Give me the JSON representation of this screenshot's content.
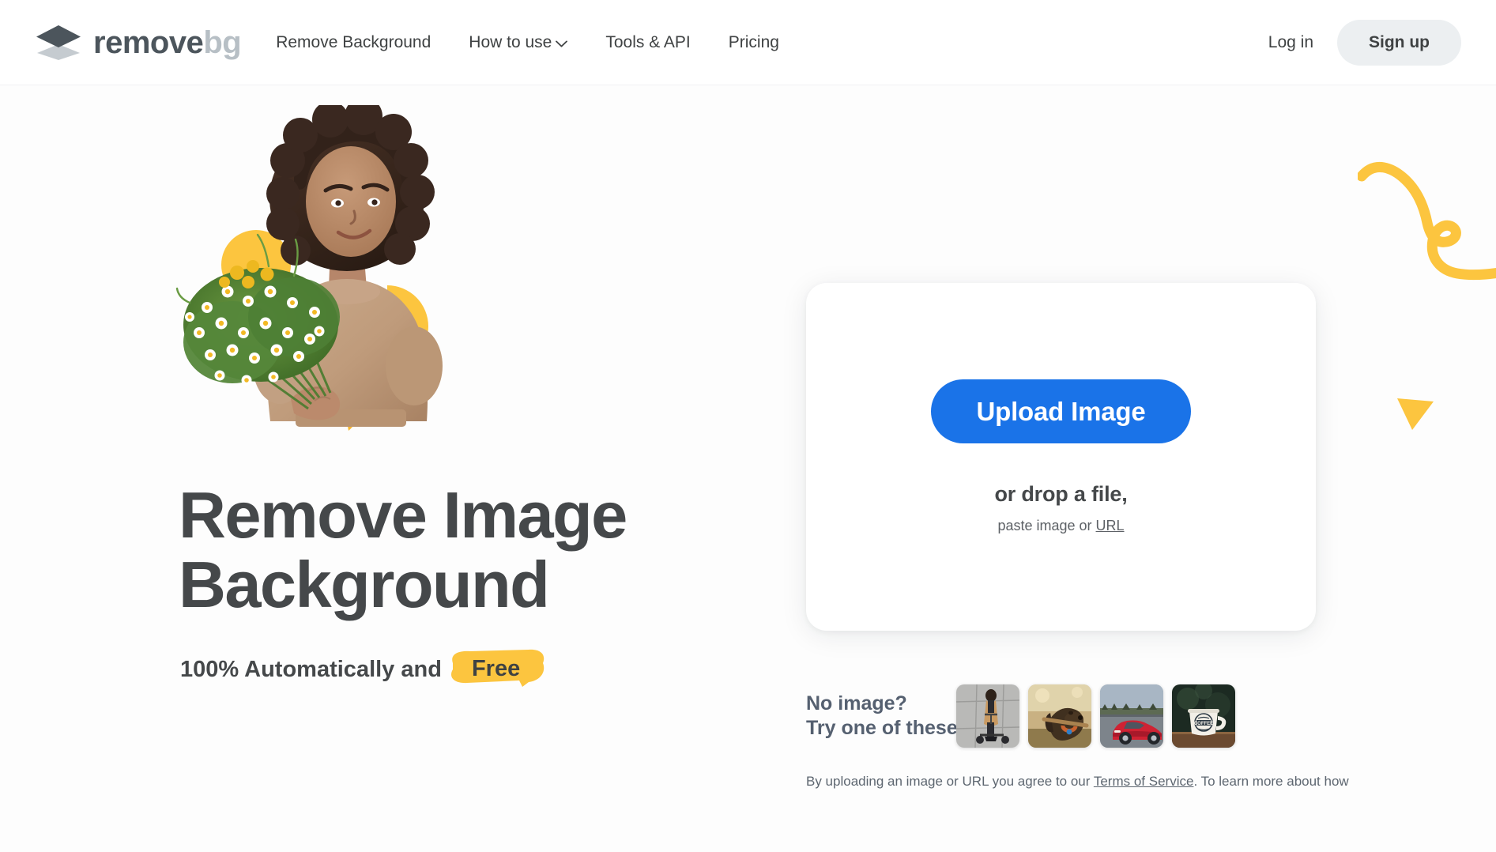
{
  "brand": {
    "name_primary": "remove",
    "name_secondary": "bg",
    "logo_icon": "layers-diamond-icon",
    "color_primary": "#4c555c",
    "color_secondary": "#b7bfc5"
  },
  "header": {
    "nav": [
      {
        "label": "Remove Background",
        "icon": null
      },
      {
        "label": "How to use",
        "icon": "chevron-down-icon"
      },
      {
        "label": "Tools & API",
        "icon": null
      },
      {
        "label": "Pricing",
        "icon": null
      }
    ],
    "login_label": "Log in",
    "signup_label": "Sign up",
    "signup_bg": "#eceff1"
  },
  "hero": {
    "image_alt": "woman-with-flower-bouquet",
    "headline_line1": "Remove Image",
    "headline_line2": "Background",
    "subhead_prefix": "100% Automatically and",
    "subhead_highlight": "Free",
    "highlight_color": "#fcc53f",
    "headline_color": "#45484a"
  },
  "upload": {
    "button_label": "Upload Image",
    "button_color": "#1a73e8",
    "drop_text": "or drop a file,",
    "paste_prefix": "paste image or ",
    "paste_link": "URL"
  },
  "samples": {
    "label_line1": "No image?",
    "label_line2": "Try one of these:",
    "thumbnails": [
      {
        "name": "woman-on-scooter"
      },
      {
        "name": "dog-with-stick"
      },
      {
        "name": "red-sports-car"
      },
      {
        "name": "coffee-mug"
      }
    ]
  },
  "legal": {
    "prefix": "By uploading an image or URL you agree to our ",
    "link": "Terms of Service",
    "suffix": ". To learn more about how"
  },
  "decor": {
    "squiggle_color": "#fcc53f",
    "triangle_color": "#fcc53f"
  }
}
